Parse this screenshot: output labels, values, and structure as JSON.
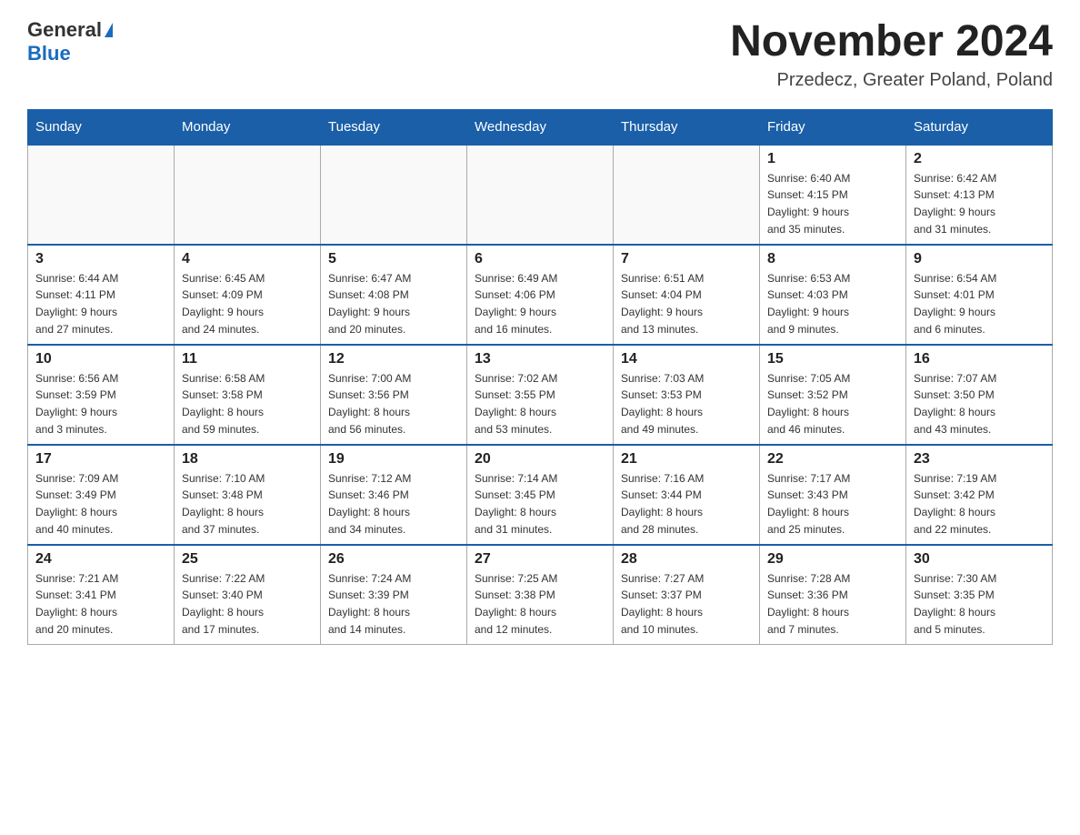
{
  "header": {
    "logo_general": "General",
    "logo_blue": "Blue",
    "month_title": "November 2024",
    "location": "Przedecz, Greater Poland, Poland"
  },
  "weekdays": [
    "Sunday",
    "Monday",
    "Tuesday",
    "Wednesday",
    "Thursday",
    "Friday",
    "Saturday"
  ],
  "weeks": [
    [
      {
        "day": "",
        "info": ""
      },
      {
        "day": "",
        "info": ""
      },
      {
        "day": "",
        "info": ""
      },
      {
        "day": "",
        "info": ""
      },
      {
        "day": "",
        "info": ""
      },
      {
        "day": "1",
        "info": "Sunrise: 6:40 AM\nSunset: 4:15 PM\nDaylight: 9 hours\nand 35 minutes."
      },
      {
        "day": "2",
        "info": "Sunrise: 6:42 AM\nSunset: 4:13 PM\nDaylight: 9 hours\nand 31 minutes."
      }
    ],
    [
      {
        "day": "3",
        "info": "Sunrise: 6:44 AM\nSunset: 4:11 PM\nDaylight: 9 hours\nand 27 minutes."
      },
      {
        "day": "4",
        "info": "Sunrise: 6:45 AM\nSunset: 4:09 PM\nDaylight: 9 hours\nand 24 minutes."
      },
      {
        "day": "5",
        "info": "Sunrise: 6:47 AM\nSunset: 4:08 PM\nDaylight: 9 hours\nand 20 minutes."
      },
      {
        "day": "6",
        "info": "Sunrise: 6:49 AM\nSunset: 4:06 PM\nDaylight: 9 hours\nand 16 minutes."
      },
      {
        "day": "7",
        "info": "Sunrise: 6:51 AM\nSunset: 4:04 PM\nDaylight: 9 hours\nand 13 minutes."
      },
      {
        "day": "8",
        "info": "Sunrise: 6:53 AM\nSunset: 4:03 PM\nDaylight: 9 hours\nand 9 minutes."
      },
      {
        "day": "9",
        "info": "Sunrise: 6:54 AM\nSunset: 4:01 PM\nDaylight: 9 hours\nand 6 minutes."
      }
    ],
    [
      {
        "day": "10",
        "info": "Sunrise: 6:56 AM\nSunset: 3:59 PM\nDaylight: 9 hours\nand 3 minutes."
      },
      {
        "day": "11",
        "info": "Sunrise: 6:58 AM\nSunset: 3:58 PM\nDaylight: 8 hours\nand 59 minutes."
      },
      {
        "day": "12",
        "info": "Sunrise: 7:00 AM\nSunset: 3:56 PM\nDaylight: 8 hours\nand 56 minutes."
      },
      {
        "day": "13",
        "info": "Sunrise: 7:02 AM\nSunset: 3:55 PM\nDaylight: 8 hours\nand 53 minutes."
      },
      {
        "day": "14",
        "info": "Sunrise: 7:03 AM\nSunset: 3:53 PM\nDaylight: 8 hours\nand 49 minutes."
      },
      {
        "day": "15",
        "info": "Sunrise: 7:05 AM\nSunset: 3:52 PM\nDaylight: 8 hours\nand 46 minutes."
      },
      {
        "day": "16",
        "info": "Sunrise: 7:07 AM\nSunset: 3:50 PM\nDaylight: 8 hours\nand 43 minutes."
      }
    ],
    [
      {
        "day": "17",
        "info": "Sunrise: 7:09 AM\nSunset: 3:49 PM\nDaylight: 8 hours\nand 40 minutes."
      },
      {
        "day": "18",
        "info": "Sunrise: 7:10 AM\nSunset: 3:48 PM\nDaylight: 8 hours\nand 37 minutes."
      },
      {
        "day": "19",
        "info": "Sunrise: 7:12 AM\nSunset: 3:46 PM\nDaylight: 8 hours\nand 34 minutes."
      },
      {
        "day": "20",
        "info": "Sunrise: 7:14 AM\nSunset: 3:45 PM\nDaylight: 8 hours\nand 31 minutes."
      },
      {
        "day": "21",
        "info": "Sunrise: 7:16 AM\nSunset: 3:44 PM\nDaylight: 8 hours\nand 28 minutes."
      },
      {
        "day": "22",
        "info": "Sunrise: 7:17 AM\nSunset: 3:43 PM\nDaylight: 8 hours\nand 25 minutes."
      },
      {
        "day": "23",
        "info": "Sunrise: 7:19 AM\nSunset: 3:42 PM\nDaylight: 8 hours\nand 22 minutes."
      }
    ],
    [
      {
        "day": "24",
        "info": "Sunrise: 7:21 AM\nSunset: 3:41 PM\nDaylight: 8 hours\nand 20 minutes."
      },
      {
        "day": "25",
        "info": "Sunrise: 7:22 AM\nSunset: 3:40 PM\nDaylight: 8 hours\nand 17 minutes."
      },
      {
        "day": "26",
        "info": "Sunrise: 7:24 AM\nSunset: 3:39 PM\nDaylight: 8 hours\nand 14 minutes."
      },
      {
        "day": "27",
        "info": "Sunrise: 7:25 AM\nSunset: 3:38 PM\nDaylight: 8 hours\nand 12 minutes."
      },
      {
        "day": "28",
        "info": "Sunrise: 7:27 AM\nSunset: 3:37 PM\nDaylight: 8 hours\nand 10 minutes."
      },
      {
        "day": "29",
        "info": "Sunrise: 7:28 AM\nSunset: 3:36 PM\nDaylight: 8 hours\nand 7 minutes."
      },
      {
        "day": "30",
        "info": "Sunrise: 7:30 AM\nSunset: 3:35 PM\nDaylight: 8 hours\nand 5 minutes."
      }
    ]
  ]
}
